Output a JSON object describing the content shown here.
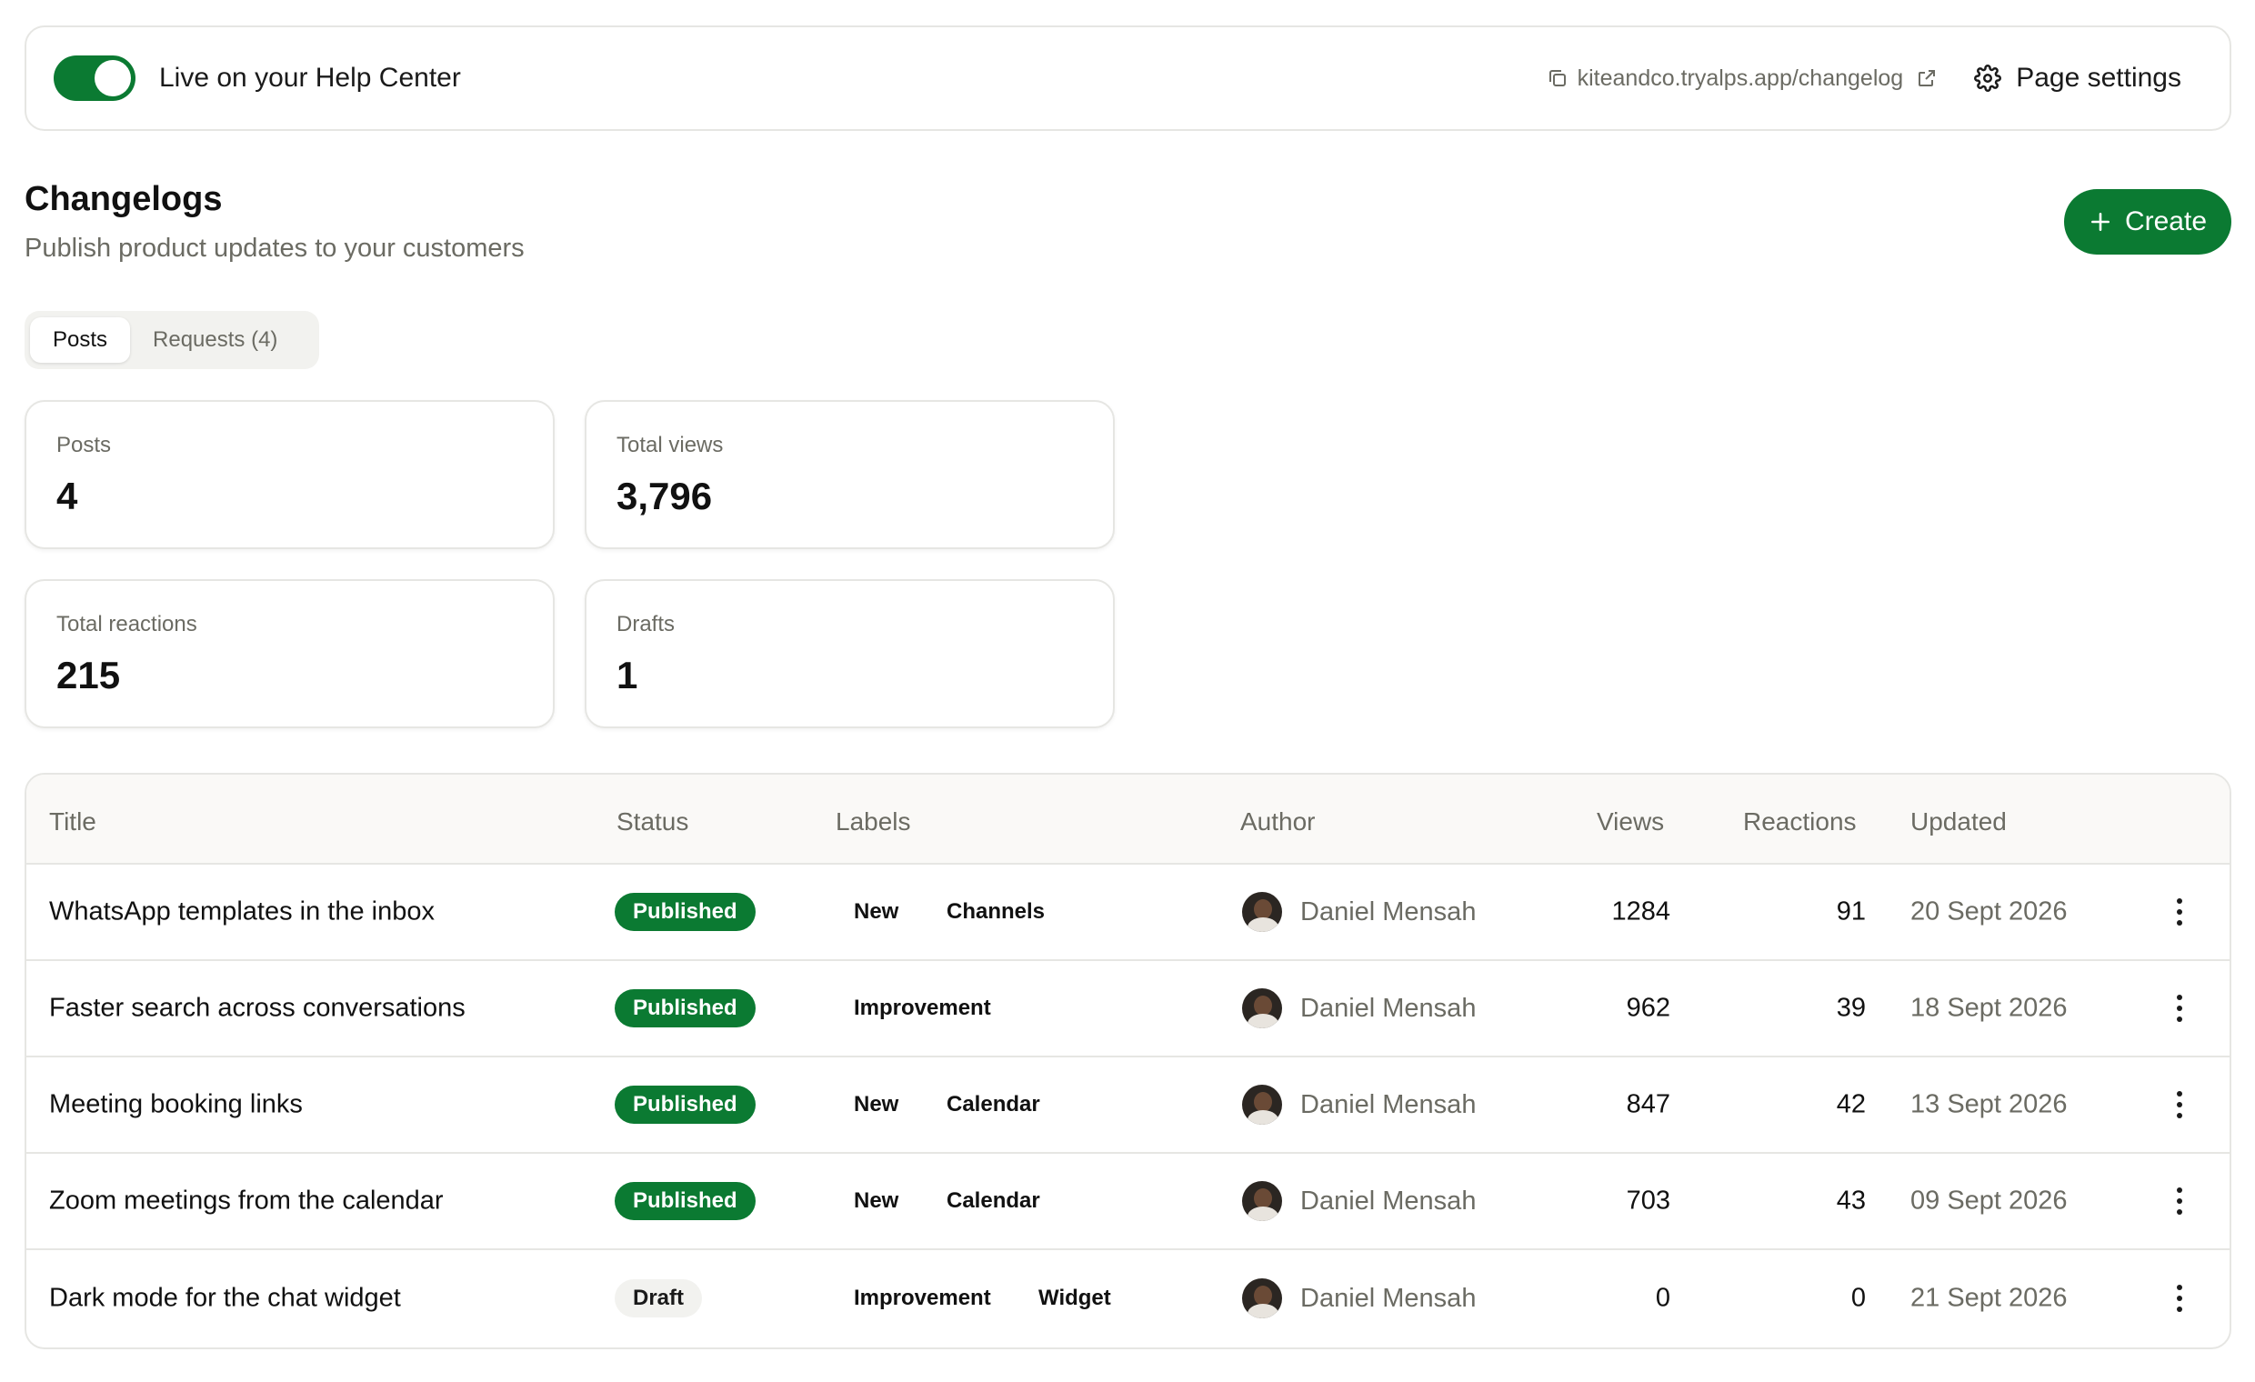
{
  "topbar": {
    "live_label": "Live on your Help Center",
    "live_enabled": true,
    "url": "kiteandco.tryalps.app/changelog",
    "settings_label": "Page settings"
  },
  "header": {
    "title": "Changelogs",
    "subtitle": "Publish product updates to your customers",
    "create_label": "Create"
  },
  "tabs": [
    {
      "label": "Posts",
      "active": true
    },
    {
      "label": "Requests (4)",
      "active": false
    }
  ],
  "stats": [
    {
      "label": "Posts",
      "value": "4"
    },
    {
      "label": "Total views",
      "value": "3,796"
    },
    {
      "label": "Total reactions",
      "value": "215"
    },
    {
      "label": "Drafts",
      "value": "1"
    }
  ],
  "table": {
    "columns": [
      "Title",
      "Status",
      "Labels",
      "Author",
      "Views",
      "Reactions",
      "Updated"
    ],
    "rows": [
      {
        "title": "WhatsApp templates in the inbox",
        "status": "Published",
        "labels": [
          "New",
          "Channels"
        ],
        "author": "Daniel Mensah",
        "views": "1284",
        "reactions": "91",
        "updated": "20 Sept 2026"
      },
      {
        "title": "Faster search across conversations",
        "status": "Published",
        "labels": [
          "Improvement"
        ],
        "author": "Daniel Mensah",
        "views": "962",
        "reactions": "39",
        "updated": "18 Sept 2026"
      },
      {
        "title": "Meeting booking links",
        "status": "Published",
        "labels": [
          "New",
          "Calendar"
        ],
        "author": "Daniel Mensah",
        "views": "847",
        "reactions": "42",
        "updated": "13 Sept 2026"
      },
      {
        "title": "Zoom meetings from the calendar",
        "status": "Published",
        "labels": [
          "New",
          "Calendar"
        ],
        "author": "Daniel Mensah",
        "views": "703",
        "reactions": "43",
        "updated": "09 Sept 2026"
      },
      {
        "title": "Dark mode for the chat widget",
        "status": "Draft",
        "labels": [
          "Improvement",
          "Widget"
        ],
        "author": "Daniel Mensah",
        "views": "0",
        "reactions": "0",
        "updated": "21 Sept 2026"
      }
    ]
  },
  "colors": {
    "accent": "#0b7a32",
    "muted_text": "#6b6b63",
    "border": "#e6e6e3"
  },
  "icons": [
    "copy-icon",
    "external-link-icon",
    "gear-icon",
    "plus-icon",
    "more-vertical-icon"
  ]
}
